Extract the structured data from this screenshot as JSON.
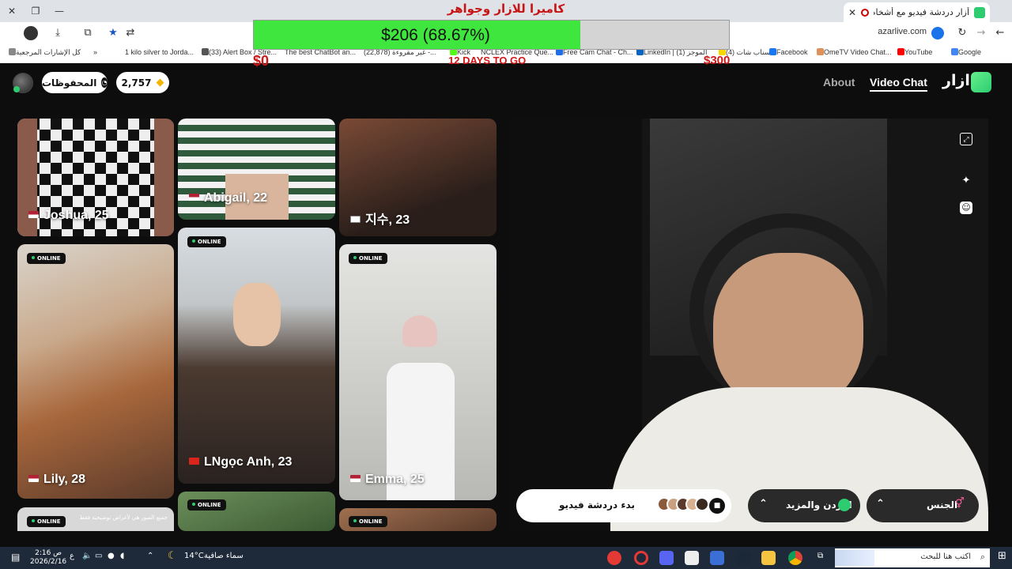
{
  "browser": {
    "tab_title": "أزار دردشة فيديو مع أشخاص",
    "url": "azarlive.com",
    "bookmarks": [
      "كل الإشارات المرجعية",
      "1 kilo silver to Jorda...",
      "(33) Alert Box / Stre...",
      "The best ChatBot an...",
      "(22,878) غير مقروءة -...",
      "Kick",
      "NCLEX Practice Que...",
      "Free Cam Chat - Ch...",
      "LinkedIn | (1) الموجز",
      "(4) سناب شات",
      "Facebook",
      "OmeTV Video Chat...",
      "YouTube",
      "Google"
    ]
  },
  "overlay": {
    "title": "كاميرا للازار وجواهر",
    "progress_text": "$206 (68.67%)",
    "progress_value": 0.6867,
    "start_amount": "$0",
    "goal_amount": "$300",
    "days_left": "12 DAYS TO GO"
  },
  "header": {
    "gems": "2,757",
    "saved": "المحفوظات",
    "nav_about": "About",
    "nav_video_chat": "Video Chat",
    "logo": "ازار"
  },
  "cards": {
    "online_label": "ONLINE",
    "c1": "Joshua, 25",
    "c2": "Abigail, 22",
    "c3": "지수, 23",
    "c4": "Lily, 28",
    "c5": "LNgọc Anh, 23",
    "c6": "Emma, 25",
    "disclaimer": "جميع الصور هي لأغراض توضيحية فقط"
  },
  "controls": {
    "start_chat": "بدء دردشة فيديو",
    "region": "الأردن والمزيد",
    "gender": "الجنس"
  },
  "taskbar": {
    "search": "اكتب هنا للبحث",
    "weather_temp": "14°C",
    "weather_text": "سماء صافية",
    "time": "2:16 ص",
    "date": "2026/2/16",
    "lang": "ع"
  },
  "colors": {
    "accent_green": "#2ecc71",
    "progress_green": "#3ee63e",
    "overlay_red": "#d01818"
  }
}
